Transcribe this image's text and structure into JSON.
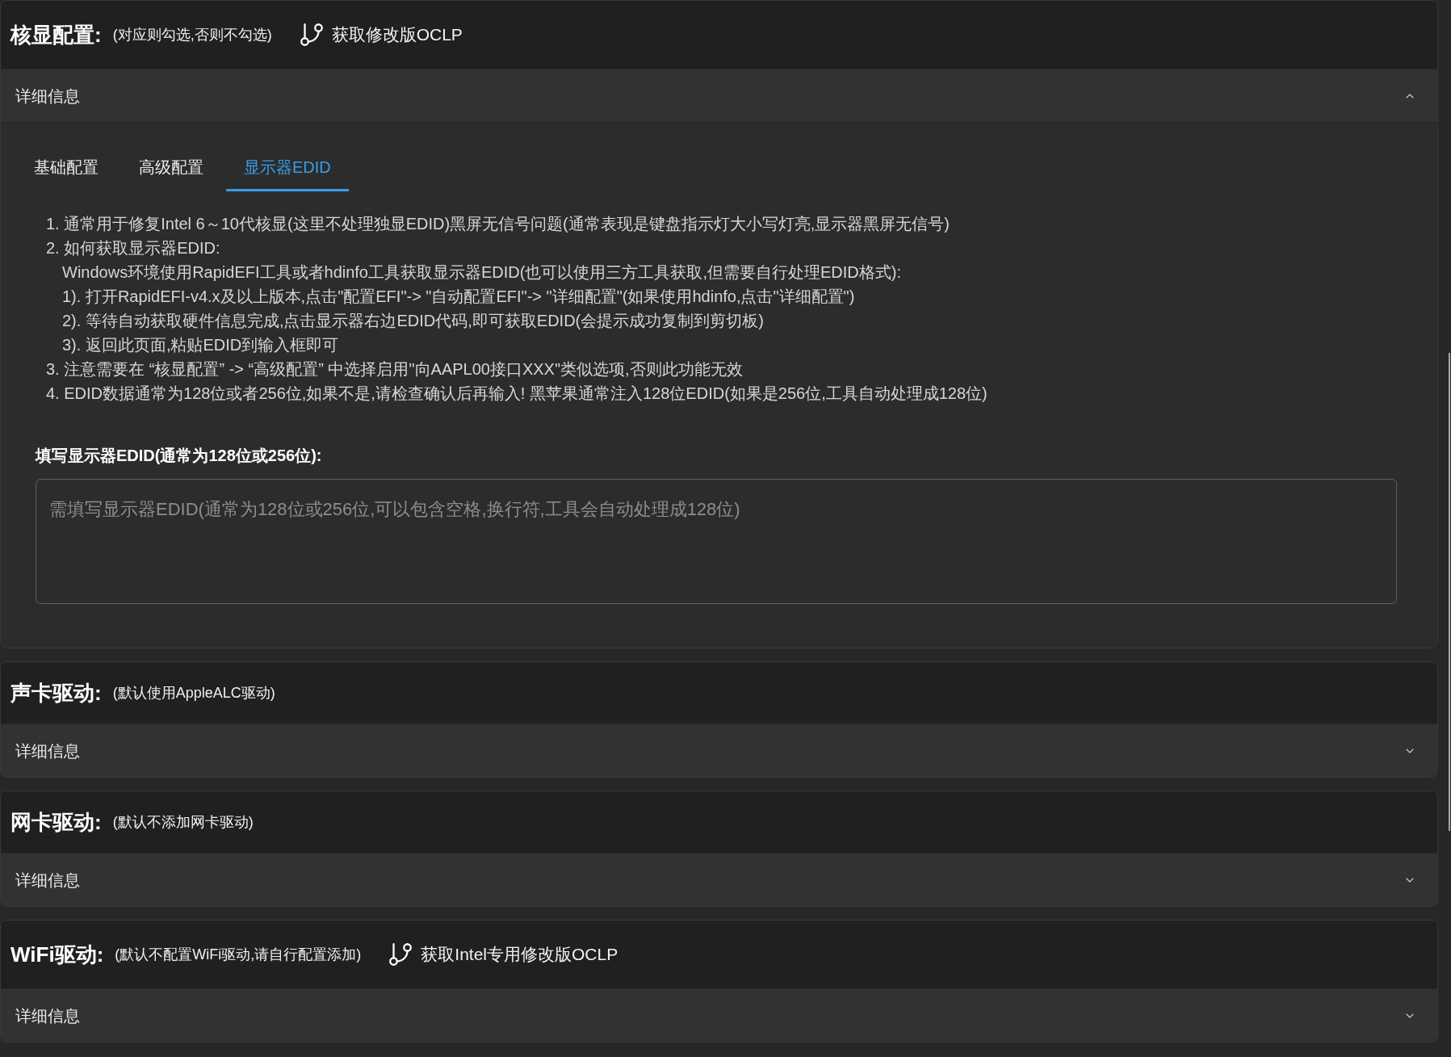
{
  "sections": [
    {
      "title": "核显配置:",
      "note": "(对应则勾选,否则不勾选)",
      "link": {
        "label": "获取修改版OCLP"
      },
      "details": {
        "label": "详细信息",
        "expanded": true,
        "tabs": [
          {
            "label": "基础配置",
            "selected": false
          },
          {
            "label": "高级配置",
            "selected": false
          },
          {
            "label": "显示器EDID",
            "selected": true
          }
        ],
        "instructions": [
          {
            "text": "1. 通常用于修复Intel 6～10代核显(这里不处理独显EDID)黑屏无信号问题(通常表现是键盘指示灯大小写灯亮,显示器黑屏无信号)"
          },
          {
            "text": "2. 如何获取显示器EDID:",
            "children": [
              {
                "text": "Windows环境使用RapidEFI工具或者hdinfo工具获取显示器EDID(也可以使用三方工具获取,但需要自行处理EDID格式):"
              },
              {
                "text": "1). 打开RapidEFI-v4.x及以上版本,点击\"配置EFI\"-> \"自动配置EFI\"-> \"详细配置\"(如果使用hdinfo,点击\"详细配置\")"
              },
              {
                "text": "2). 等待自动获取硬件信息完成,点击显示器右边EDID代码,即可获取EDID(会提示成功复制到剪切板)"
              },
              {
                "text": "3). 返回此页面,粘贴EDID到输入框即可"
              }
            ]
          },
          {
            "text": "3. 注意需要在 “核显配置” -> “高级配置” 中选择启用\"向AAPL00接口XXX\"类似选项,否则此功能无效"
          },
          {
            "text": "4. EDID数据通常为128位或者256位,如果不是,请检查确认后再输入! 黑苹果通常注入128位EDID(如果是256位,工具自动处理成128位)"
          }
        ],
        "edid_field": {
          "label": "填写显示器EDID(通常为128位或256位):",
          "placeholder": "需填写显示器EDID(通常为128位或256位,可以包含空格,换行符,工具会自动处理成128位)"
        }
      }
    },
    {
      "title": "声卡驱动:",
      "note": "(默认使用AppleALC驱动)",
      "details": {
        "label": "详细信息",
        "expanded": false
      }
    },
    {
      "title": "网卡驱动:",
      "note": "(默认不添加网卡驱动)",
      "details": {
        "label": "详细信息",
        "expanded": false
      }
    },
    {
      "title": "WiFi驱动:",
      "note": "(默认不配置WiFi驱动,请自行配置添加)",
      "link": {
        "label": "获取Intel专用修改版OCLP"
      },
      "details": {
        "label": "详细信息",
        "expanded": false
      }
    }
  ]
}
